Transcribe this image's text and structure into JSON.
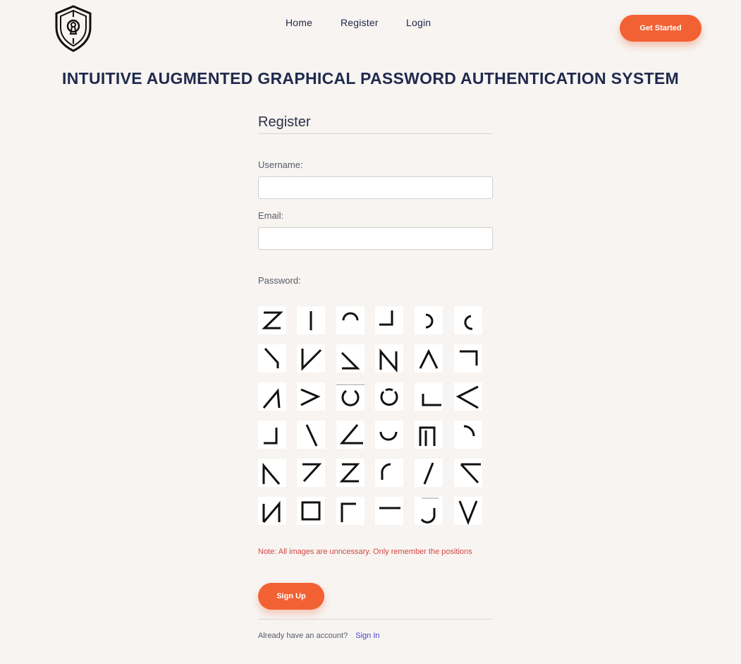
{
  "nav": {
    "items": [
      {
        "id": "home",
        "label": "Home"
      },
      {
        "id": "register",
        "label": "Register"
      },
      {
        "id": "login",
        "label": "Login"
      }
    ],
    "cta_label": "Get Started"
  },
  "headline": "INTUITIVE AUGMENTED GRAPHICAL PASSWORD AUTHENTICATION SYSTEM",
  "form": {
    "title": "Register",
    "username_label": "Username:",
    "username_value": "",
    "email_label": "Email:",
    "email_value": "",
    "password_label": "Password:",
    "note": "Note: All images are unncessary. Only remember the positions",
    "submit_label": "Sign Up",
    "signin_prompt": "Already have an account?",
    "signin_link": "Sign In"
  },
  "password_grid": {
    "rows": 6,
    "cols": 6,
    "tiles": [
      "z-shape-icon",
      "vertical-line-icon",
      "arch-top-icon",
      "corner-bottom-right-icon",
      "arc-right-icon",
      "arc-left-small-icon",
      "diagonal-v-left-icon",
      "v-right-icon",
      "diagonal-z-small-icon",
      "n-shape-icon",
      "caret-up-icon",
      "corner-top-right-icon",
      "caret-up-left-icon",
      "greater-than-icon",
      "circle-broken-icon",
      "circle-icon",
      "corner-bottom-left-icon",
      "less-than-icon",
      "corner-bottom-right-small-icon",
      "backslash-icon",
      "angle-left-icon",
      "u-shape-icon",
      "square-open-icon",
      "arc-top-right-icon",
      "n-diagonal-icon",
      "seven-shape-icon",
      "z-bold-icon",
      "arc-left-icon",
      "slash-icon",
      "angle-top-left-icon",
      "n-reverse-icon",
      "square-icon",
      "corner-top-left-icon",
      "horizontal-line-icon",
      "j-hook-icon",
      "v-shape-icon"
    ]
  },
  "colors": {
    "background": "#f7f4f1",
    "accent": "#f26134",
    "headline": "#1f2a4d",
    "note": "#d64545",
    "link": "#4b3fd6"
  }
}
